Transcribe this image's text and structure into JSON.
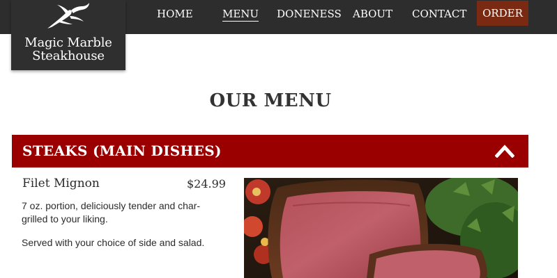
{
  "brand": {
    "name_line1": "Magic Marble",
    "name_line2": "Steakhouse",
    "logo_icon": "bull-horns-icon"
  },
  "nav": {
    "items": [
      {
        "label": "HOME"
      },
      {
        "label": "MENU",
        "active": true
      },
      {
        "label": "DONENESS"
      },
      {
        "label": "ABOUT"
      },
      {
        "label": "CONTACT"
      },
      {
        "label": "ORDER"
      }
    ]
  },
  "page": {
    "title": "OUR MENU"
  },
  "section": {
    "title": "STEAKS (MAIN DISHES)",
    "toggle_icon": "chevron-up-icon",
    "expanded": true
  },
  "item": {
    "name": "Filet Mignon",
    "price": "$24.99",
    "description": "7 oz. portion, deliciously tender and char-grilled to your liking.",
    "served": "Served with your choice of side and salad.",
    "photo_icon": "steak-photo"
  },
  "colors": {
    "topbar": "#2d2d2d",
    "section_bar": "#9b0000",
    "order_button": "#7a2a12",
    "text": "#2b2b2b"
  }
}
